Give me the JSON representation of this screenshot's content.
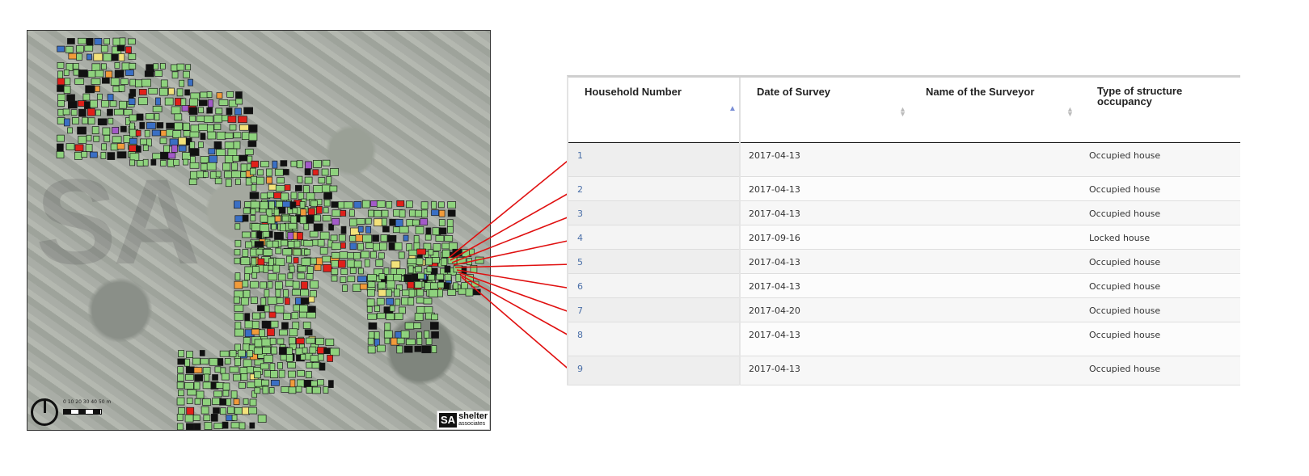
{
  "map": {
    "watermark": "SA",
    "scale_text": "0 10 20 30 40 50 m",
    "logo_mark": "SA",
    "logo_name": "shelter",
    "logo_sub": "associates",
    "colors": {
      "plot_green": "#8ed27d",
      "plot_black": "#111111",
      "plot_red": "#e0201a",
      "plot_blue": "#3a6fc4",
      "plot_orange": "#f29b3a",
      "plot_purple": "#a35ac8",
      "plot_yellow": "#f3e27a",
      "connector_red": "#e01010"
    }
  },
  "table": {
    "columns": [
      {
        "label": "Household Number",
        "sort": "asc"
      },
      {
        "label": "Date of Survey",
        "sort": "none"
      },
      {
        "label": "Name of the Surveyor",
        "sort": "none"
      },
      {
        "label": "Type of structure occupancy",
        "sort": "none"
      }
    ],
    "rows": [
      {
        "household": "1",
        "date": "2017-04-13",
        "surveyor": "",
        "occupancy": "Occupied house"
      },
      {
        "household": "2",
        "date": "2017-04-13",
        "surveyor": "",
        "occupancy": "Occupied house"
      },
      {
        "household": "3",
        "date": "2017-04-13",
        "surveyor": "",
        "occupancy": "Occupied house"
      },
      {
        "household": "4",
        "date": "2017-09-16",
        "surveyor": "",
        "occupancy": "Locked house"
      },
      {
        "household": "5",
        "date": "2017-04-13",
        "surveyor": "",
        "occupancy": "Occupied house"
      },
      {
        "household": "6",
        "date": "2017-04-13",
        "surveyor": "",
        "occupancy": "Occupied house"
      },
      {
        "household": "7",
        "date": "2017-04-20",
        "surveyor": "",
        "occupancy": "Occupied house"
      },
      {
        "household": "8",
        "date": "2017-04-13",
        "surveyor": "",
        "occupancy": "Occupied house"
      },
      {
        "household": "9",
        "date": "2017-04-13",
        "surveyor": "",
        "occupancy": "Occupied house"
      }
    ]
  }
}
